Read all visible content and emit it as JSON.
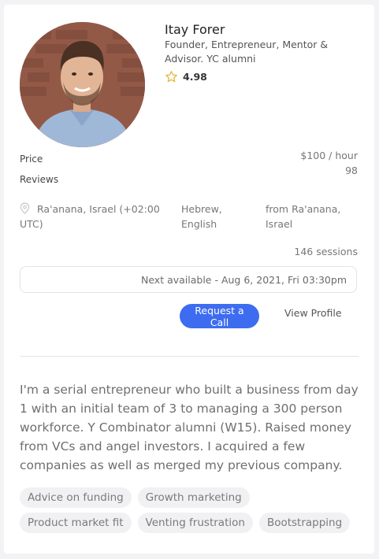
{
  "profile": {
    "name": "Itay Forer",
    "headline": "Founder, Entrepreneur, Mentor & Advisor. YC alumni",
    "rating": "4.98"
  },
  "stats": {
    "price_label": "Price",
    "price_value": "$100 / hour",
    "reviews_label": "Reviews",
    "reviews_value": "98"
  },
  "details": {
    "location": "Ra'anana, Israel (+02:00 UTC)",
    "languages": "Hebrew, English",
    "from": "from Ra'anana, Israel",
    "sessions": "146 sessions"
  },
  "availability": {
    "next": "Next available - Aug 6, 2021, Fri 03:30pm"
  },
  "actions": {
    "request_call": "Request a Call",
    "view_profile": "View Profile"
  },
  "bio": "I'm a serial entrepreneur who built a business from day 1 with an initial team of 3 to managing a 300 person workforce. Y Combinator alumni (W15). Raised money from VCs and angel investors. I acquired a few companies as well as merged my previous company.",
  "tags": [
    "Advice on funding",
    "Growth marketing",
    "Product market fit",
    "Venting frustration",
    "Bootstrapping"
  ],
  "colors": {
    "accent": "#3d6cf0",
    "star": "#e0b93a"
  },
  "icons": [
    "star-icon",
    "location-pin-icon"
  ]
}
